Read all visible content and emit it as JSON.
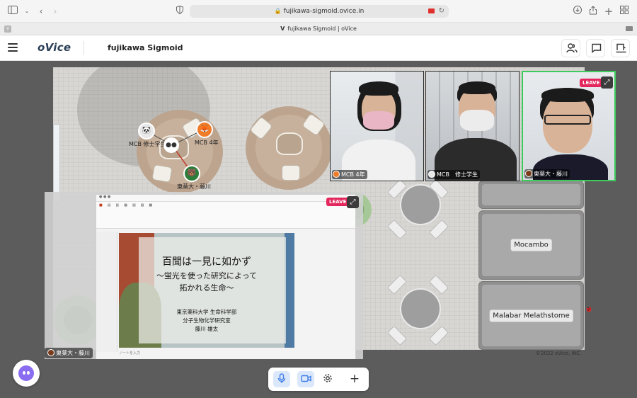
{
  "browser": {
    "url": "fujikawa-sigmoid.ovice.in",
    "tab_title_brand": "fujikawa Sigmoid",
    "tab_title_rest": "| oVice",
    "favicon_letter": "Y"
  },
  "app": {
    "logo": "oVice",
    "space_name": "fujikawa Sigmoid",
    "header_buttons": [
      "members-icon",
      "chat-icon",
      "board-icon"
    ]
  },
  "map": {
    "booths": [
      "Mocambo",
      "Malabar Melathstome"
    ],
    "avatars": [
      {
        "label": "MCB 修士学生",
        "color": "#e8e8e8"
      },
      {
        "label": "MCB 4年",
        "color": "#f07c2a"
      },
      {
        "label": "東薬大・藤川",
        "color": "#2f7d3a"
      }
    ],
    "copyright": "©2022 oVice, INC."
  },
  "videos": [
    {
      "name": "MCB 4年"
    },
    {
      "name": "MCB　修士学生"
    },
    {
      "name": "東薬大・藤川",
      "active": true
    }
  ],
  "leave_label": "LEAVE",
  "share": {
    "presenter": "東薬大・藤川",
    "slide": {
      "title": "百聞は一見に如かず",
      "subtitle_line1": "〜蛍光を使った研究によって",
      "subtitle_line2": "拓かれる生命〜",
      "line1": "東京薬科大学 生命科学部",
      "line2": "分子生物化学研究室",
      "line3": "藤川 雄太"
    },
    "notes_label": "ノートを入力"
  },
  "toolbar": {
    "items": [
      "microphone-icon",
      "camera-icon",
      "settings-icon",
      "plus-icon"
    ],
    "accent": "#3f7ee8"
  }
}
